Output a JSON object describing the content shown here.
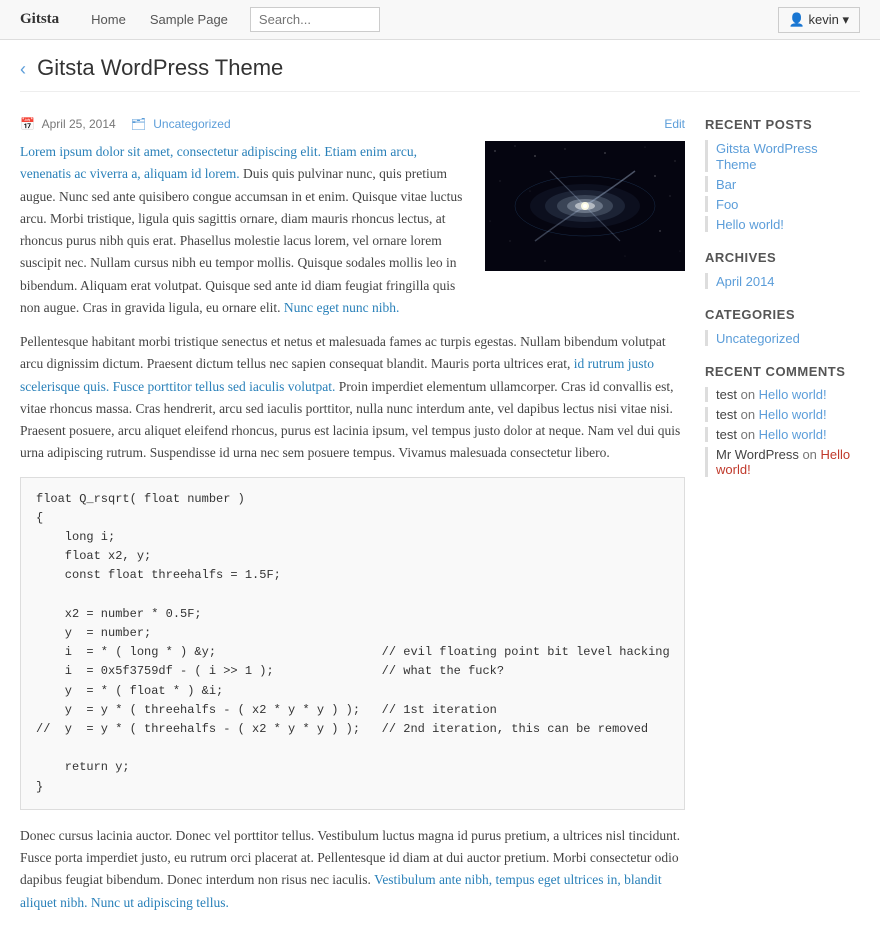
{
  "navbar": {
    "brand": "Gitsta",
    "links": [
      "Home",
      "Sample Page"
    ],
    "search_placeholder": "Search...",
    "user_label": "kevin"
  },
  "page": {
    "title": "Gitsta WordPress Theme",
    "chevron": "‹"
  },
  "post": {
    "date": "April 25, 2014",
    "category": "Uncategorized",
    "edit_label": "Edit",
    "body_p1": "Lorem ipsum dolor sit amet, consectetur adipiscing elit. Etiam enim arcu, venenatis ac viverra a, aliquam id lorem. Duis quis pulvinar nunc, quis pretium augue. Nunc sed ante quisibero congue accumsan in et enim. Quisque vitae luctus arcu. Morbi tristique, ligula quis sagittis ornare, diam mauris rhoncus lectus, at rhoncus purus nibh quis erat. Phasellus molestie lacus lorem, vel ornare lorem suscipit nec. Nullam cursus nibh eu tempor mollis. Quisque sodales mollis leo in bibendum. Aliquam erat volutpat. Quisque sed ante id diam feugiat fringilla quis non augue. Cras in gravida ligula, eu ornare elit. Nunc eget nunc nibh.",
    "body_p2": "Pellentesque habitant morbi tristique senectus et netus et malesuada fames ac turpis egestas. Nullam bibendum volutpat arcu dignissim dictum. Praesent dictum tellus nec sapien consequat blandit. Mauris porta ultrices erat, id rutrum justo scelerisque quis. Fusce porttitor tellus sed iaculis volutpat. Proin imperdiet elementum ullamcorper. Cras id convallis est, vitae rhoncus massa. Cras hendrerit, arcu sed iaculis porttitor, nulla nunc interdum ante, vel dapibus lectus nisi vitae nisi. Praesent posuere, arcu aliquet eleifend rhoncus, purus est lacinia ipsum, vel tempus justo dolor at neque. Nam vel dui quis urna adipiscing rutrum. Suspendisse id urna nec sem posuere tempus. Vivamus malesuada consectetur libero.",
    "code": "float Q_rsqrt( float number )\n{\n    long i;\n    float x2, y;\n    const float threehalfs = 1.5F;\n\n    x2 = number * 0.5F;\n    y  = number;\n    i  = * ( long * ) &y;                       // evil floating point bit level hacking\n    i  = 0x5f3759df - ( i >> 1 );               // what the fuck?\n    y  = * ( float * ) &i;\n    y  = y * ( threehalfs - ( x2 * y * y ) );   // 1st iteration\n//  y  = y * ( threehalfs - ( x2 * y * y ) );   // 2nd iteration, this can be removed\n\n    return y;\n}",
    "body_p3": "Donec cursus lacinia auctor. Donec vel porttitor tellus. Vestibulum luctus magna id purus pretium, a ultrices nisl tincidunt. Fusce porta imperdiet justo, eu rutrum orci placerat at. Pellentesque id diam at dui auctor pretium. Morbi consectetur odio dapibus feugiat bibendum. Donec interdum non risus nec iaculis. Vestibulum ante nibh, tempus eget ultrices in, blandit aliquet nibh. Nunc ut adipiscing tellus."
  },
  "sidebar": {
    "recent_posts_title": "RECENT POSTS",
    "recent_posts": [
      {
        "label": "Gitsta WordPress Theme"
      },
      {
        "label": "Bar"
      },
      {
        "label": "Foo"
      },
      {
        "label": "Hello world!"
      }
    ],
    "archives_title": "ARCHIVES",
    "archives": [
      {
        "label": "April 2014"
      }
    ],
    "categories_title": "CATEGORIES",
    "categories": [
      {
        "label": "Uncategorized"
      }
    ],
    "recent_comments_title": "RECENT COMMENTS",
    "recent_comments": [
      {
        "commenter": "test",
        "on": "Hello world!",
        "mr_wp": false
      },
      {
        "commenter": "test",
        "on": "Hello world!",
        "mr_wp": false
      },
      {
        "commenter": "test",
        "on": "Hello world!",
        "mr_wp": false
      },
      {
        "commenter": "Mr WordPress",
        "on": "Hello world!",
        "mr_wp": true
      }
    ]
  }
}
